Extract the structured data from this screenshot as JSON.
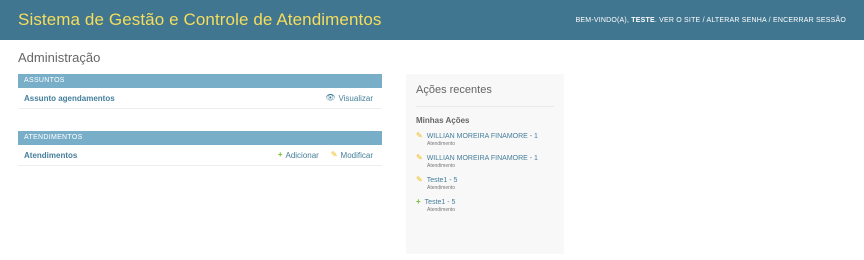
{
  "header": {
    "site_name": "Sistema de Gestão e Controle de Atendimentos",
    "welcome": "BEM-VINDO(A),",
    "username": "TESTE",
    "links": [
      "VER O SITE",
      "ALTERAR SENHA",
      "ENCERRAR SESSÃO"
    ],
    "separator": " / "
  },
  "page": {
    "title": "Administração"
  },
  "modules": [
    {
      "caption": "ASSUNTOS",
      "models": [
        {
          "name": "Assunto agendamentos",
          "actions": [
            {
              "label": "Visualizar",
              "icon": "eye-icon"
            }
          ]
        }
      ]
    },
    {
      "caption": "ATENDIMENTOS",
      "models": [
        {
          "name": "Atendimentos",
          "actions": [
            {
              "label": "Adicionar",
              "icon": "add-icon"
            },
            {
              "label": "Modificar",
              "icon": "edit-icon"
            }
          ]
        }
      ]
    }
  ],
  "recent_actions": {
    "title": "Ações recentes",
    "subtitle": "Minhas Ações",
    "items": [
      {
        "label": "WILLIAN MOREIRA FINAMORE - 1",
        "type": "Atendimento",
        "icon": "edit-icon"
      },
      {
        "label": "WILLIAN MOREIRA FINAMORE - 1",
        "type": "Atendimento",
        "icon": "edit-icon"
      },
      {
        "label": "Teste1 - 5",
        "type": "Atendimento",
        "icon": "edit-icon"
      },
      {
        "label": "Teste1 - 5",
        "type": "Atendimento",
        "icon": "add-icon"
      }
    ]
  },
  "colors": {
    "header_bg": "#417690",
    "brand": "#f5dd5d",
    "module_caption": "#79aec8",
    "link": "#447e9b",
    "add": "#70bf2b",
    "edit": "#efb80b"
  }
}
